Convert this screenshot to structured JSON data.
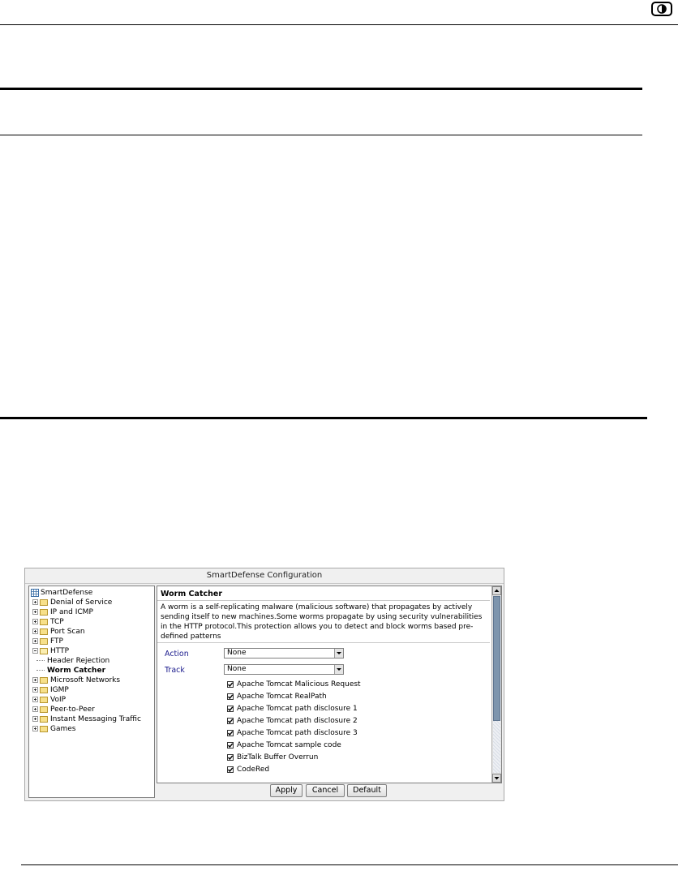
{
  "dialog": {
    "title": "SmartDefense Configuration",
    "tree": {
      "items": [
        {
          "label": "SmartDefense",
          "type": "root"
        },
        {
          "label": "Denial of Service",
          "type": "folder"
        },
        {
          "label": "IP and ICMP",
          "type": "folder"
        },
        {
          "label": "TCP",
          "type": "folder"
        },
        {
          "label": "Port Scan",
          "type": "folder"
        },
        {
          "label": "FTP",
          "type": "folder"
        },
        {
          "label": "HTTP",
          "type": "folder-open"
        },
        {
          "label": "Header Rejection",
          "type": "leaf"
        },
        {
          "label": "Worm Catcher",
          "type": "leaf-selected"
        },
        {
          "label": "Microsoft Networks",
          "type": "folder"
        },
        {
          "label": "IGMP",
          "type": "folder"
        },
        {
          "label": "VoIP",
          "type": "folder"
        },
        {
          "label": "Peer-to-Peer",
          "type": "folder"
        },
        {
          "label": "Instant Messaging Traffic",
          "type": "folder"
        },
        {
          "label": "Games",
          "type": "folder"
        }
      ]
    },
    "panel": {
      "title": "Worm Catcher",
      "description": "A worm is a self-replicating malware (malicious software) that propagates by actively sending itself to new machines.Some worms propagate by using security vulnerabilities in the HTTP protocol.This protection allows you to detect and block worms based pre-defined patterns",
      "action_label": "Action",
      "action_value": "None",
      "track_label": "Track",
      "track_value": "None",
      "checks": [
        {
          "label": "Apache Tomcat Malicious Request",
          "checked": true
        },
        {
          "label": "Apache Tomcat RealPath",
          "checked": true
        },
        {
          "label": "Apache Tomcat path disclosure 1",
          "checked": true
        },
        {
          "label": "Apache Tomcat path disclosure 2",
          "checked": true
        },
        {
          "label": "Apache Tomcat path disclosure 3",
          "checked": true
        },
        {
          "label": "Apache Tomcat sample code",
          "checked": true
        },
        {
          "label": "BizTalk Buffer Overrun",
          "checked": true
        },
        {
          "label": "CodeRed",
          "checked": true
        }
      ]
    },
    "buttons": {
      "apply": "Apply",
      "cancel": "Cancel",
      "default": "Default"
    }
  }
}
